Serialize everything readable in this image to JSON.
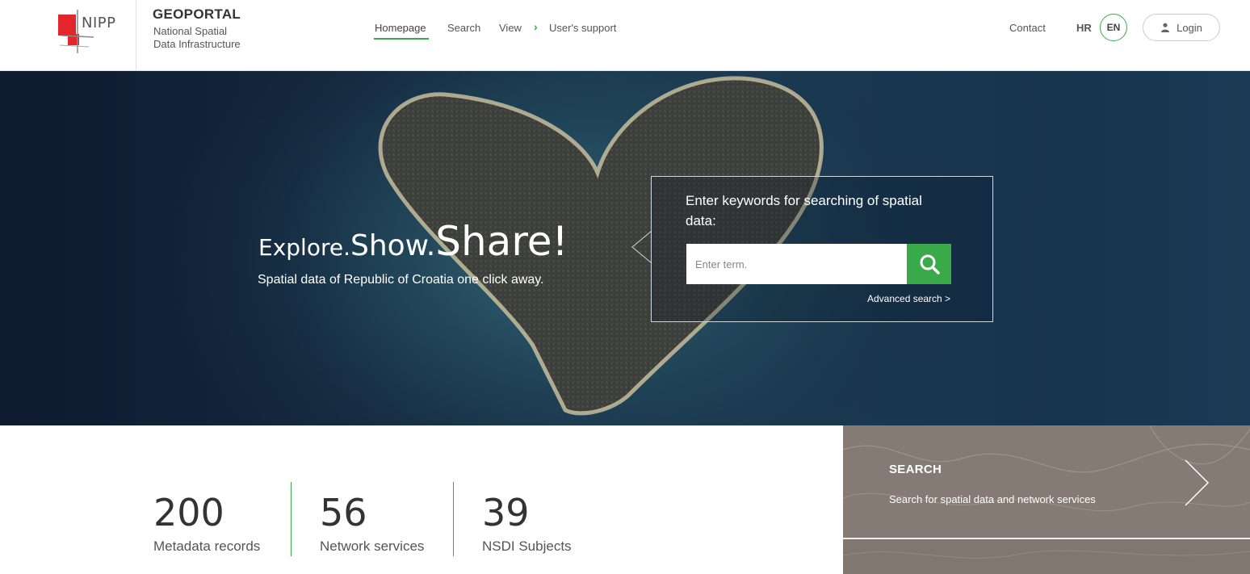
{
  "header": {
    "logo_text": "NIPP",
    "title": "GEOPORTAL",
    "subtitle_line1": "National Spatial",
    "subtitle_line2": "Data Infrastructure",
    "nav": {
      "home": "Homepage",
      "search": "Search",
      "view": "View",
      "support": "User's support"
    },
    "contact": "Contact",
    "lang_hr": "HR",
    "lang_en": "EN",
    "login": "Login"
  },
  "hero": {
    "title_explore": "Explore.",
    "title_show": "Show.",
    "title_share": "Share!",
    "subtitle": "Spatial data of Republic of Croatia one click away.",
    "search_prompt": "Enter keywords for searching of spatial data:",
    "search_placeholder": "Enter term.",
    "advanced_search": "Advanced search >"
  },
  "stats": [
    {
      "value": "200",
      "label": "Metadata records"
    },
    {
      "value": "56",
      "label": "Network services"
    },
    {
      "value": "39",
      "label": "NSDI Subjects"
    }
  ],
  "panel": {
    "title": "SEARCH",
    "text": "Search for spatial data and network services"
  },
  "colors": {
    "accent_green": "#3aa94a",
    "logo_red": "#e3262b",
    "hero_dark": "#0d1a2f",
    "panel_taupe": "#857b74"
  },
  "icons": {
    "search": "magnifier-icon",
    "user": "user-icon",
    "chevron": "chevron-right-icon",
    "arrow": "arrow-right-icon"
  }
}
